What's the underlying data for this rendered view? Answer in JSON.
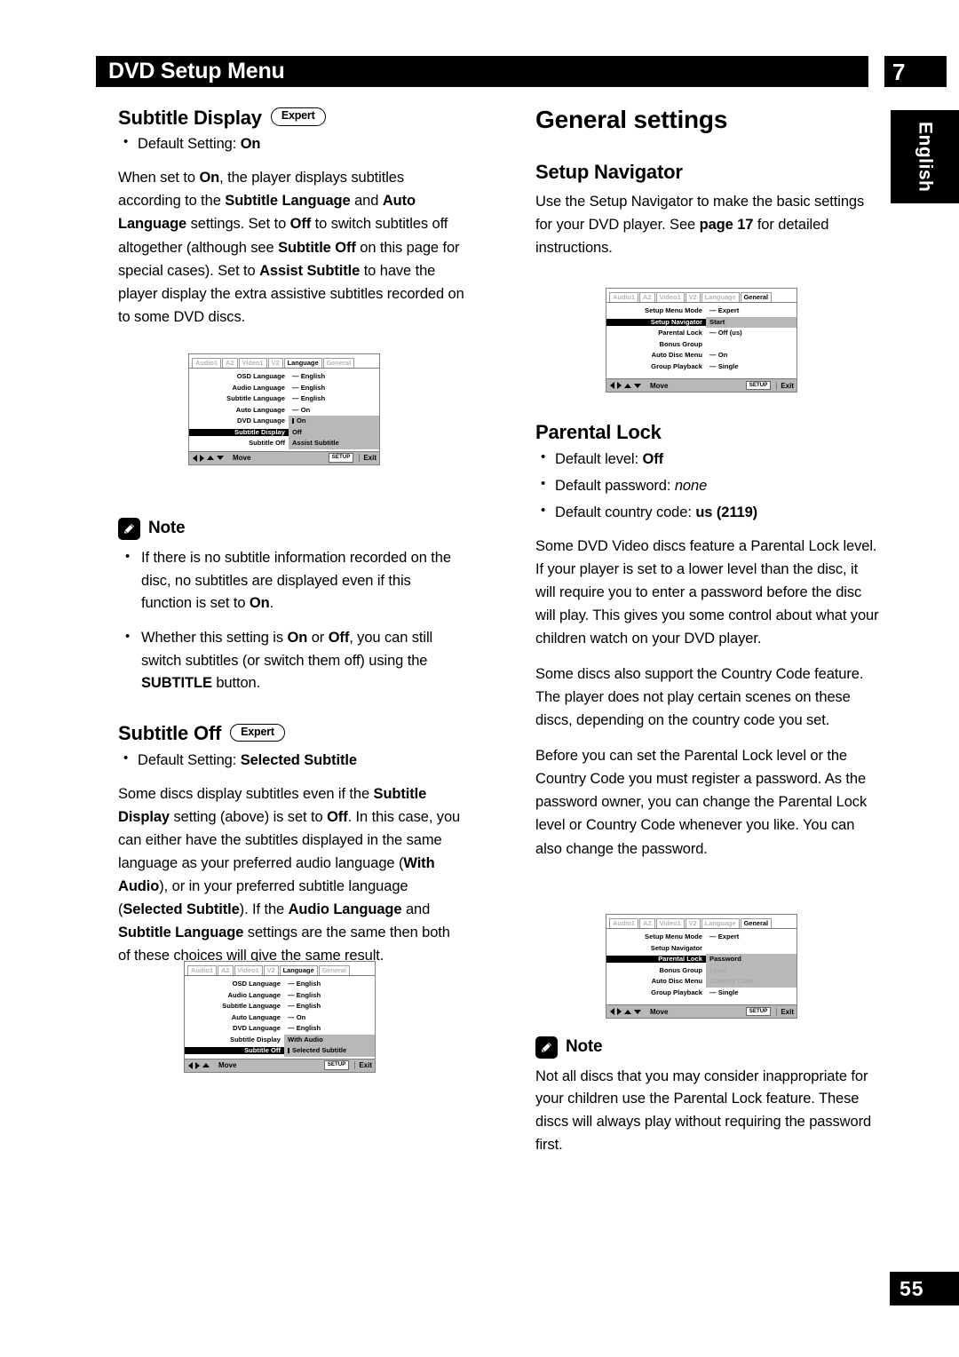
{
  "header": {
    "title": "DVD Setup Menu",
    "chapter": "7",
    "language_tab": "English",
    "page_number": "55"
  },
  "left_column": {
    "subtitle_display": {
      "heading": "Subtitle Display",
      "badge": "Expert",
      "default_bullet_prefix": "Default Setting: ",
      "default_bullet_value": "On",
      "paragraph": "When set to On, the player displays subtitles according to the Subtitle Language and Auto Language settings. Set to Off to switch subtitles off altogether (although see Subtitle Off on this page for special cases). Set to Assist Subtitle to have the player display the extra assistive subtitles recorded on to some DVD discs."
    },
    "note1": {
      "label": "Note",
      "bullets": [
        "If there is no subtitle information recorded on the disc, no subtitles are displayed even if this function is set to On.",
        "Whether this setting is On or Off, you can still switch subtitles (or switch them off) using the SUBTITLE button."
      ]
    },
    "subtitle_off": {
      "heading": "Subtitle Off",
      "badge": "Expert",
      "default_bullet_prefix": "Default Setting: ",
      "default_bullet_value": "Selected Subtitle",
      "paragraph": "Some discs display subtitles even if the Subtitle Display setting (above) is set to Off. In this case, you can either have the subtitles displayed in the same language as your preferred audio language (With Audio), or in your preferred subtitle language (Selected Subtitle). If the Audio Language and Subtitle Language settings are the same then both of these choices will give the same result."
    }
  },
  "right_column": {
    "general_settings_heading": "General settings",
    "setup_navigator": {
      "heading": "Setup Navigator",
      "paragraph": "Use the Setup Navigator to make the basic settings for your DVD player. See page 17 for detailed instructions.",
      "page_ref": "page 17"
    },
    "parental_lock": {
      "heading": "Parental Lock",
      "bullets": [
        {
          "prefix": "Default level: ",
          "value": "Off",
          "style": "bold"
        },
        {
          "prefix": "Default password: ",
          "value": "none",
          "style": "italic"
        },
        {
          "prefix": "Default country code: ",
          "value": "us (2119)",
          "style": "bold"
        }
      ],
      "paragraphs": [
        "Some DVD Video discs feature a Parental Lock level. If your player is set to a lower level than the disc, it will require you to enter a password before the disc will play. This gives you some control about what your children watch on your DVD player.",
        "Some discs also support the Country Code feature. The player does not play certain scenes on these discs, depending on the country code you set.",
        "Before you can set the Parental Lock level or the Country Code you must register a password. As the password owner, you can change the Parental Lock level or Country Code whenever you like. You can also change the password."
      ]
    },
    "note2": {
      "label": "Note",
      "text": "Not all discs that you may consider inappropriate for your children use the Parental Lock feature. These discs will always play without requiring the password first."
    }
  },
  "osd_screens": [
    {
      "id": "subtitle-display-osd",
      "tabs": [
        "Audio1",
        "A2",
        "Video1",
        "V2",
        "Language",
        "General"
      ],
      "active_tab": "Language",
      "rows": [
        {
          "label": "OSD Language",
          "value": "— English"
        },
        {
          "label": "Audio Language",
          "value": "— English"
        },
        {
          "label": "Subtitle Language",
          "value": "— English"
        },
        {
          "label": "Auto Language",
          "value": "— On"
        },
        {
          "label": "DVD Language",
          "value": "On"
        },
        {
          "label": "Subtitle Display",
          "value": "Off"
        },
        {
          "label": "Subtitle Off",
          "value": "Assist Subtitle"
        }
      ],
      "selected_row_index": 5,
      "cursor_row_index": 4,
      "footer": {
        "move": "Move",
        "setup": "SETUP",
        "exit": "Exit"
      },
      "arrows": [
        "left",
        "right",
        "up",
        "down"
      ]
    },
    {
      "id": "subtitle-off-osd",
      "tabs": [
        "Audio1",
        "A2",
        "Video1",
        "V2",
        "Language",
        "General"
      ],
      "active_tab": "Language",
      "rows": [
        {
          "label": "OSD Language",
          "value": "— English"
        },
        {
          "label": "Audio Language",
          "value": "— English"
        },
        {
          "label": "Subtitle Language",
          "value": "— English"
        },
        {
          "label": "Auto Language",
          "value": "— On"
        },
        {
          "label": "DVD Language",
          "value": "— English"
        },
        {
          "label": "Subtitle Display",
          "value": "With Audio"
        },
        {
          "label": "Subtitle Off",
          "value": "Selected Subtitle"
        }
      ],
      "selected_row_index": 6,
      "cursor_row_index": 6,
      "footer": {
        "move": "Move",
        "setup": "SETUP",
        "exit": "Exit"
      },
      "arrows": [
        "left",
        "right",
        "up"
      ]
    },
    {
      "id": "setup-navigator-osd",
      "tabs": [
        "Audio1",
        "A2",
        "Video1",
        "V2",
        "Language",
        "General"
      ],
      "active_tab": "General",
      "rows": [
        {
          "label": "Setup Menu Mode",
          "value": "— Expert"
        },
        {
          "label": "Setup Navigator",
          "value": "Start"
        },
        {
          "label": "Parental Lock",
          "value": "— Off (us)"
        },
        {
          "label": "Bonus Group",
          "value": ""
        },
        {
          "label": "Auto Disc Menu",
          "value": "— On"
        },
        {
          "label": "Group Playback",
          "value": "— Single"
        }
      ],
      "selected_row_index": 1,
      "cursor_row_index": -1,
      "footer": {
        "move": "Move",
        "setup": "SETUP",
        "exit": "Exit"
      },
      "arrows": [
        "left",
        "right",
        "up",
        "down"
      ]
    },
    {
      "id": "parental-lock-osd",
      "tabs": [
        "Audio1",
        "A2",
        "Video1",
        "V2",
        "Language",
        "General"
      ],
      "active_tab": "General",
      "rows": [
        {
          "label": "Setup Menu Mode",
          "value": "— Expert"
        },
        {
          "label": "Setup Navigator",
          "value": ""
        },
        {
          "label": "Parental Lock",
          "value": "Password"
        },
        {
          "label": "Bonus Group",
          "value": "Level",
          "dim": true
        },
        {
          "label": "Auto Disc Menu",
          "value": "Country Code",
          "dim": true
        },
        {
          "label": "Group Playback",
          "value": "— Single"
        }
      ],
      "selected_row_index": 2,
      "cursor_row_index": -1,
      "footer": {
        "move": "Move",
        "setup": "SETUP",
        "exit": "Exit"
      },
      "arrows": [
        "left",
        "right",
        "up",
        "down"
      ]
    }
  ]
}
